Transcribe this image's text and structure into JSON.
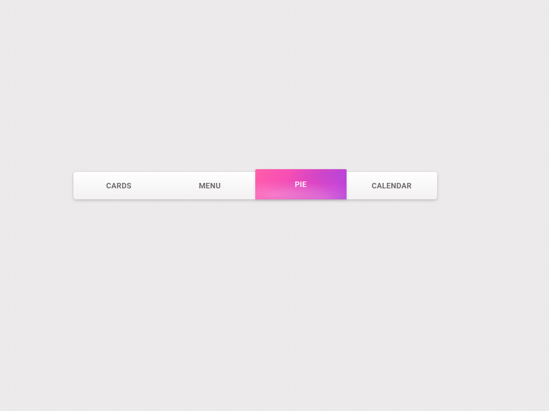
{
  "nav": {
    "items": [
      {
        "label": "Cards",
        "active": false
      },
      {
        "label": "Menu",
        "active": false
      },
      {
        "label": "Pie",
        "active": true
      },
      {
        "label": "Calendar",
        "active": false
      }
    ]
  }
}
